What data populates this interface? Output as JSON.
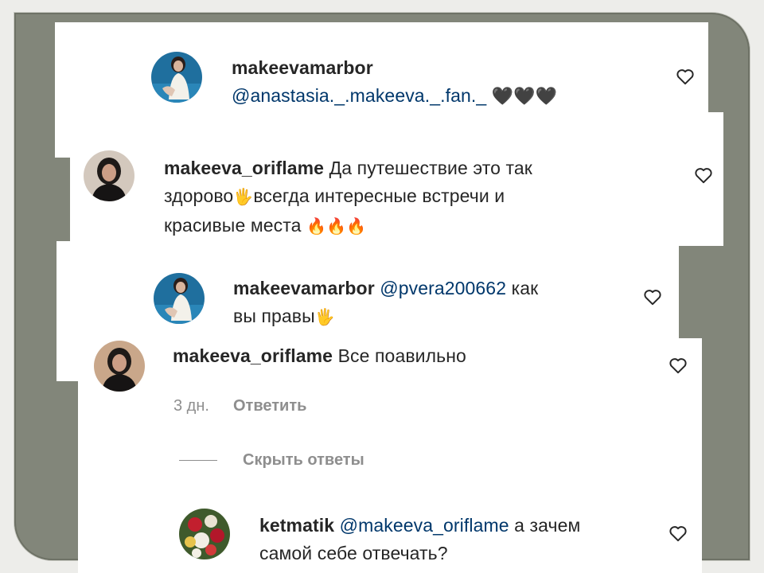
{
  "comments": [
    {
      "user": "makeevamarbor",
      "mention": "@anastasia._.makeeva._.fan._",
      "text_end": "🖤🖤🖤"
    },
    {
      "user": "makeeva_oriflame",
      "text_line1": "Да путешествие это так",
      "text_line2a": "здорово",
      "text_line2b": "всегда интересные встречи и",
      "text_line3": "красивые места",
      "emoji_hand": "🖐",
      "emoji_fire": "🔥🔥🔥"
    },
    {
      "user": "makeevamarbor",
      "mention": "@pvera200662",
      "text_line1_end": "как",
      "text_line2": "вы правы",
      "emoji_hand": "🖐"
    },
    {
      "user": "makeeva_oriflame",
      "text": "Все поавильно",
      "time": "3 дн.",
      "reply_label": "Ответить",
      "hide_replies_label": "Скрыть ответы"
    },
    {
      "user": "ketmatik",
      "mention": "@makeeva_oriflame",
      "text_line1_end": "а зачем",
      "text_line2": "самой себе отвечать?"
    }
  ],
  "icons": {
    "heart": "heart-outline-icon",
    "avatar_1": "avatar-woman-white-dress",
    "avatar_2": "avatar-woman-dark-hair",
    "avatar_3": "avatar-flowers"
  },
  "colors": {
    "frame": "#82867a",
    "mention": "#00376b",
    "text": "#262626",
    "muted": "#8e8e8e"
  }
}
